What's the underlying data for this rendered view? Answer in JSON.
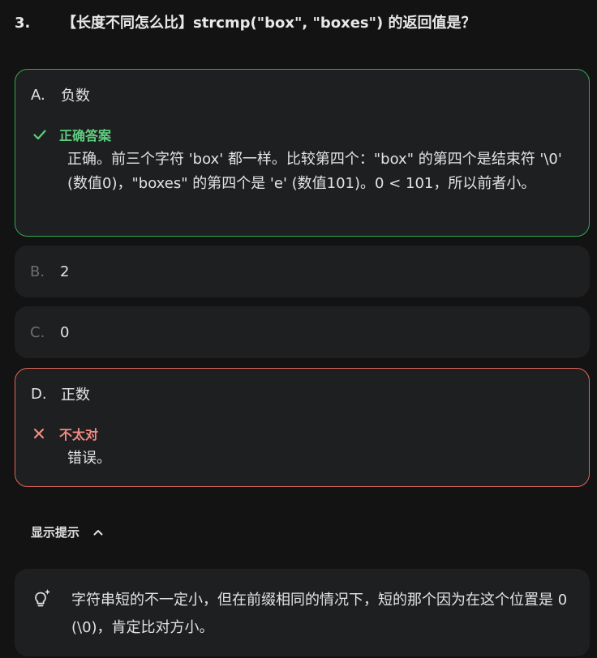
{
  "question": {
    "number": "3.",
    "text": "【长度不同怎么比】strcmp(\"box\", \"boxes\") 的返回值是？"
  },
  "options": [
    {
      "letter": "A.",
      "text": "负数",
      "state": "correct",
      "feedback_title": "正确答案",
      "feedback_text": "正确。前三个字符 'box' 都一样。比较第四个：\"box\" 的第四个是结束符 '\\0' (数值0)，\"boxes\" 的第四个是 'e' (数值101)。0 < 101，所以前者小。",
      "icon": "check-icon",
      "accent_color": "#34a853"
    },
    {
      "letter": "B.",
      "text": "2",
      "state": "neutral"
    },
    {
      "letter": "C.",
      "text": "0",
      "state": "neutral"
    },
    {
      "letter": "D.",
      "text": "正数",
      "state": "wrong",
      "feedback_title": "不太对",
      "feedback_text": "错误。",
      "icon": "close-icon",
      "accent_color": "#e0665c"
    }
  ],
  "hint": {
    "toggle_label": "显示提示",
    "toggle_icon": "chevron-up-icon",
    "icon": "lightbulb-sparkle-icon",
    "text": "字符串短的不一定小，但在前缀相同的情况下，短的那个因为在这个位置是 0 (\\0)，肯定比对方小。"
  }
}
